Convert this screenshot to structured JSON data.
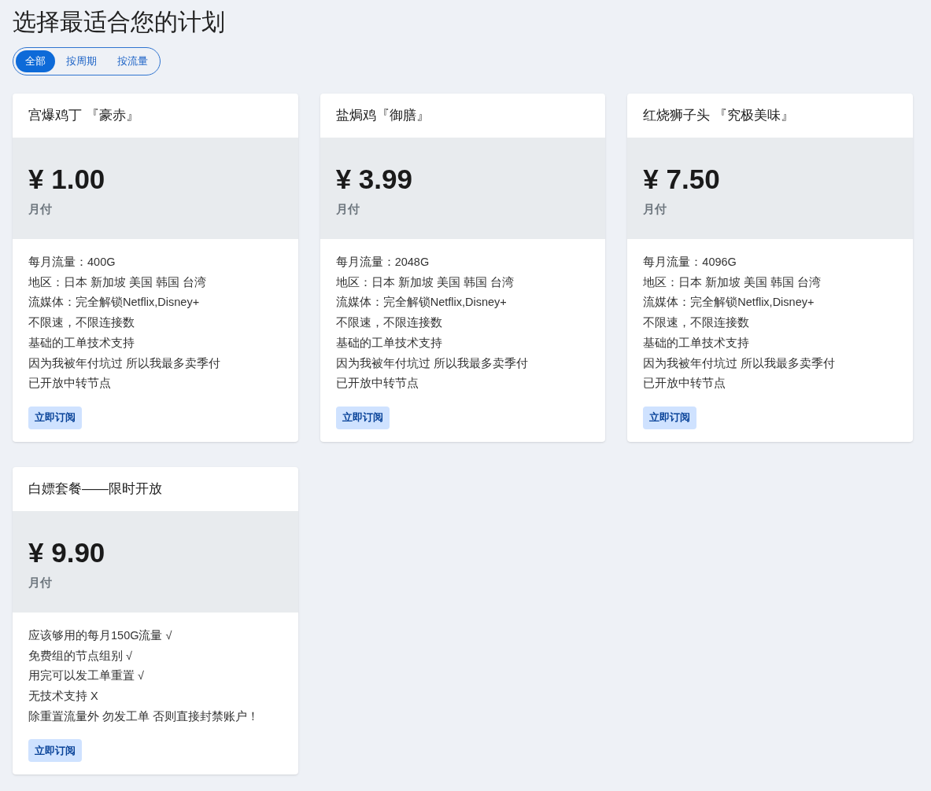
{
  "page_title": "选择最适合您的计划",
  "filter_tabs": [
    {
      "label": "全部",
      "selected": true
    },
    {
      "label": "按周期",
      "selected": false
    },
    {
      "label": "按流量",
      "selected": false
    }
  ],
  "plans": [
    {
      "name": "宫爆鸡丁 『豪赤』",
      "price": "¥ 1.00",
      "period": "月付",
      "features": [
        "每月流量：400G",
        "地区：日本 新加坡 美国 韩国 台湾",
        "流媒体：完全解锁Netflix,Disney+",
        "不限速，不限连接数",
        "基础的工单技术支持",
        "因为我被年付坑过 所以我最多卖季付",
        "已开放中转节点"
      ],
      "button": "立即订阅"
    },
    {
      "name": "盐焗鸡『御膳』",
      "price": "¥ 3.99",
      "period": "月付",
      "features": [
        "每月流量：2048G",
        "地区：日本 新加坡 美国 韩国 台湾",
        "流媒体：完全解锁Netflix,Disney+",
        "不限速，不限连接数",
        "基础的工单技术支持",
        "因为我被年付坑过 所以我最多卖季付",
        "已开放中转节点"
      ],
      "button": "立即订阅"
    },
    {
      "name": "红烧狮子头 『究极美味』",
      "price": "¥ 7.50",
      "period": "月付",
      "features": [
        "每月流量：4096G",
        "地区：日本 新加坡 美国 韩国 台湾",
        "流媒体：完全解锁Netflix,Disney+",
        "不限速，不限连接数",
        "基础的工单技术支持",
        "因为我被年付坑过 所以我最多卖季付",
        "已开放中转节点"
      ],
      "button": "立即订阅"
    },
    {
      "name": "白嫖套餐——限时开放",
      "price": "¥ 9.90",
      "period": "月付",
      "features": [
        "应该够用的每月150G流量 √",
        "免费组的节点组别 √",
        "用完可以发工单重置 √",
        "无技术支持 X",
        "除重置流量外 勿发工单 否则直接封禁账户！"
      ],
      "button": "立即订阅"
    }
  ]
}
